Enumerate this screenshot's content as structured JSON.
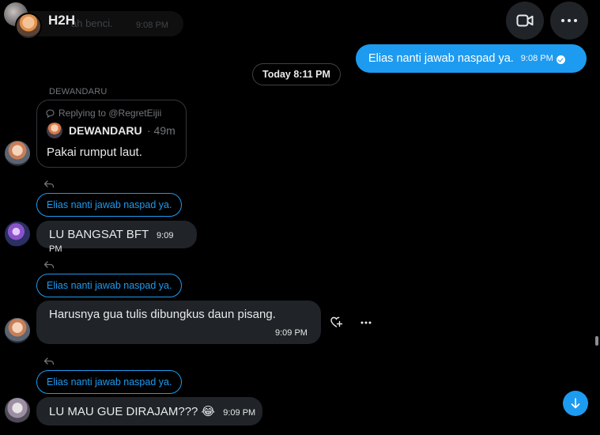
{
  "header": {
    "title": "H2H",
    "ghost_text": "ah benci.",
    "ghost_time": "9:08 PM"
  },
  "my_message": {
    "text": "Elias nanti jawab naspad ya.",
    "time": "9:08 PM"
  },
  "day_separator": "Today 8:11 PM",
  "thread": {
    "sender_name": "DEWANDARU",
    "quote": {
      "replying_to": "Replying to @RegretEijii",
      "author": "DEWANDARU",
      "age": "· 49m",
      "text": "Pakai rumput laut."
    },
    "messages": [
      {
        "reply_pill": "Elias nanti jawab naspad ya.",
        "text": "LU BANGSAT BFT",
        "time": "9:09 PM"
      },
      {
        "reply_pill": "Elias nanti jawab naspad ya.",
        "text": "Harusnya gua tulis dibungkus daun pisang.",
        "time": "9:09 PM"
      },
      {
        "reply_pill": "Elias nanti jawab naspad ya.",
        "text": "LU MAU GUE DIRAJAM??? 😂",
        "time": "9:09 PM"
      }
    ]
  },
  "colors": {
    "accent": "#1d9bf0",
    "bubble_other": "#202327",
    "background": "#000000",
    "muted": "#71767b"
  },
  "icons": [
    "video-call-icon",
    "more-icon",
    "reply-icon",
    "add-reaction-icon",
    "scroll-down-icon",
    "read-check-icon"
  ]
}
